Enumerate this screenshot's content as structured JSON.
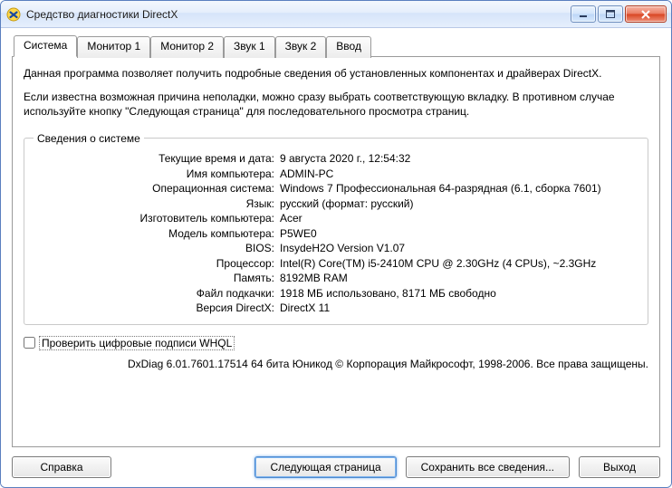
{
  "window": {
    "title": "Средство диагностики DirectX"
  },
  "tabs": [
    {
      "label": "Система"
    },
    {
      "label": "Монитор 1"
    },
    {
      "label": "Монитор 2"
    },
    {
      "label": "Звук 1"
    },
    {
      "label": "Звук 2"
    },
    {
      "label": "Ввод"
    }
  ],
  "intro": {
    "p1": "Данная программа позволяет получить подробные сведения об установленных компонентах и драйверах DirectX.",
    "p2": "Если известна возможная причина неполадки, можно сразу выбрать соответствующую вкладку. В противном случае используйте кнопку \"Следующая страница\" для последовательного просмотра страниц."
  },
  "sysinfo": {
    "legend": "Сведения о системе",
    "rows": [
      {
        "k": "Текущие время и дата:",
        "v": "9 августа 2020 г., 12:54:32"
      },
      {
        "k": "Имя компьютера:",
        "v": "ADMIN-PC"
      },
      {
        "k": "Операционная система:",
        "v": "Windows 7 Профессиональная 64-разрядная (6.1, сборка 7601)"
      },
      {
        "k": "Язык:",
        "v": "русский (формат: русский)"
      },
      {
        "k": "Изготовитель компьютера:",
        "v": "Acer"
      },
      {
        "k": "Модель компьютера:",
        "v": "P5WE0"
      },
      {
        "k": "BIOS:",
        "v": "InsydeH2O Version V1.07"
      },
      {
        "k": "Процессор:",
        "v": "Intel(R) Core(TM) i5-2410M CPU @ 2.30GHz (4 CPUs), ~2.3GHz"
      },
      {
        "k": "Память:",
        "v": "8192MB RAM"
      },
      {
        "k": "Файл подкачки:",
        "v": "1918 МБ использовано, 8171 МБ свободно"
      },
      {
        "k": "Версия DirectX:",
        "v": "DirectX 11"
      }
    ]
  },
  "whql": {
    "label": "Проверить цифровые подписи WHQL"
  },
  "footer": "DxDiag 6.01.7601.17514 64 бита Юникод  © Корпорация Майкрософт, 1998-2006.  Все права защищены.",
  "buttons": {
    "help": "Справка",
    "next": "Следующая страница",
    "saveall": "Сохранить все сведения...",
    "exit": "Выход"
  }
}
